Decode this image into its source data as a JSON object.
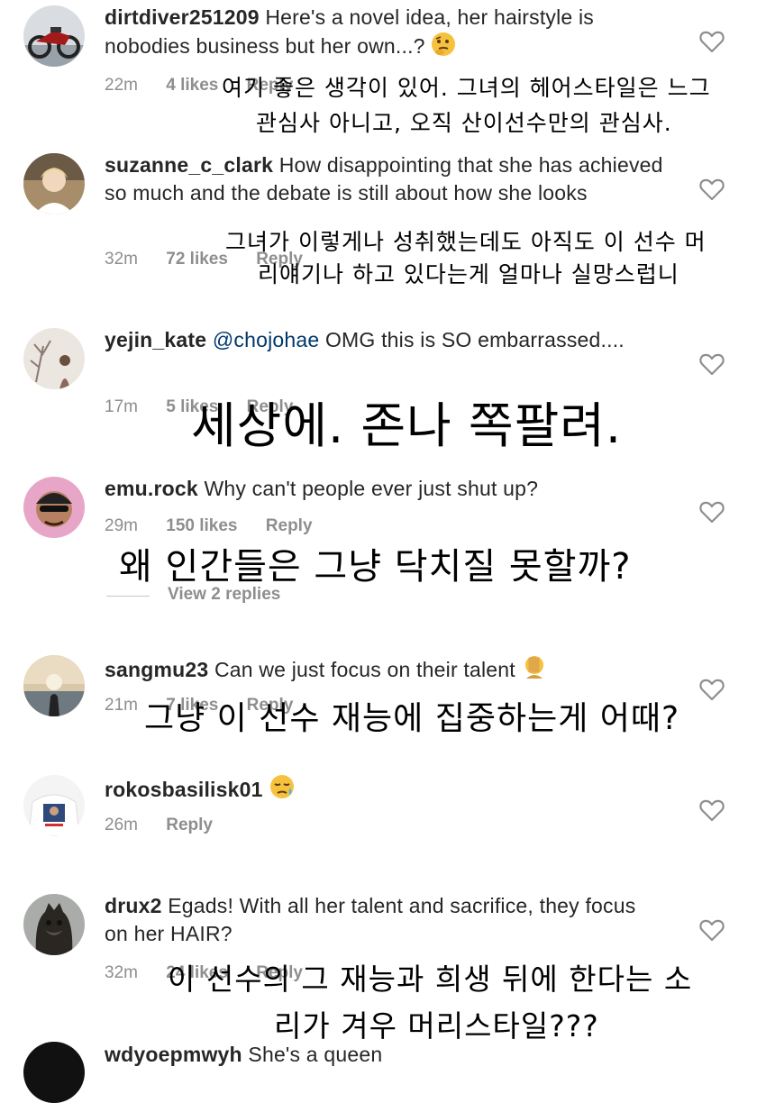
{
  "comments": [
    {
      "username": "dirtdiver251209",
      "text": "Here's a novel idea, her hairstyle is nobodies business but her own...?",
      "emoji": "thinking-face",
      "time": "22m",
      "likes": "4 likes",
      "reply": "Reply",
      "translation": [
        "여기 좋은 생각이 있어. 그녀의 헤어스타일은 느그",
        "관심사 아니고, 오직 산이선수만의 관심사."
      ]
    },
    {
      "username": "suzanne_c_clark",
      "text": "How disappointing that she has achieved so much and the debate is still about how she looks",
      "time": "32m",
      "likes": "72 likes",
      "reply": "Reply",
      "translation": [
        "그녀가 이렇게나 성취했는데도 아직도 이 선수 머",
        "리얘기나 하고 있다는게 얼마나 실망스럽니"
      ]
    },
    {
      "username": "yejin_kate",
      "mention": "@chojohae",
      "text": "OMG this is SO embarrassed....",
      "time": "17m",
      "likes": "5 likes",
      "reply": "Reply",
      "translation": [
        "세상에. 존나 쪽팔려."
      ]
    },
    {
      "username": "emu.rock",
      "text": "Why can't people ever just shut up?",
      "time": "29m",
      "likes": "150 likes",
      "reply": "Reply",
      "view_replies": "View 2 replies",
      "translation": [
        "왜 인간들은 그냥 닥치질 못할까?"
      ]
    },
    {
      "username": "sangmu23",
      "text": "Can we just focus on their talent",
      "emoji": "face-palm",
      "time": "21m",
      "likes": "7 likes",
      "reply": "Reply",
      "translation": [
        "그냥 이 선수 재능에 집중하는게 어때?"
      ]
    },
    {
      "username": "rokosbasilisk01",
      "text": "",
      "emoji": "sad-relieved-face",
      "time": "26m",
      "reply": "Reply"
    },
    {
      "username": "drux2",
      "text": "Egads!  With all her talent and sacrifice, they focus on her HAIR?",
      "time": "32m",
      "likes": "24 likes",
      "reply": "Reply",
      "translation": [
        "이 선수의 그 재능과 희생 뒤에 한다는 소",
        "리가 겨우 머리스타일???"
      ]
    },
    {
      "username": "wdyoepmwyh",
      "text": "She's a queen"
    }
  ],
  "colors": {
    "text": "#262626",
    "meta": "#8e8e8e",
    "mention": "#00376b",
    "overlay": "#000000"
  }
}
